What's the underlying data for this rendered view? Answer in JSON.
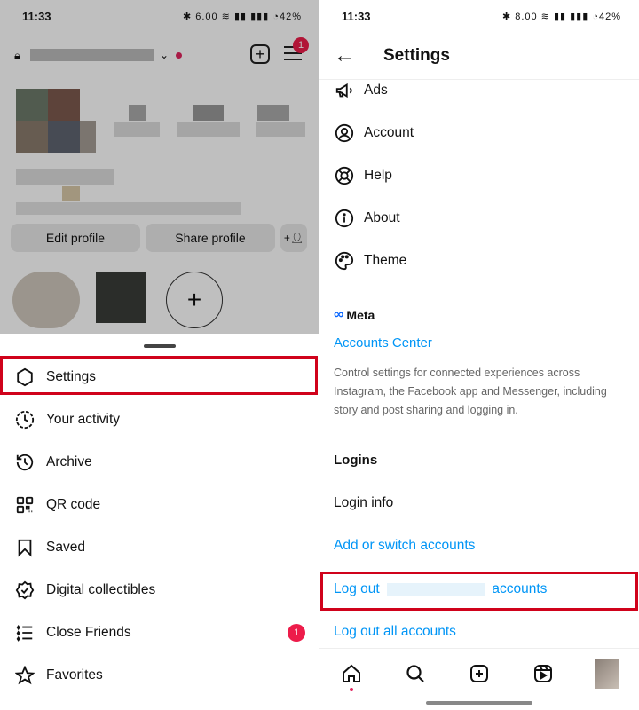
{
  "left": {
    "status": {
      "time": "11:33",
      "icons": "✱ 6.00 ≋ ▮▮ ▮▮▮ ◔42%"
    },
    "menu_badge": "1",
    "profile_buttons": {
      "edit": "Edit profile",
      "share": "Share profile"
    },
    "sheet_items": [
      {
        "label": "Settings",
        "icon": "settings-icon"
      },
      {
        "label": "Your activity",
        "icon": "activity-icon"
      },
      {
        "label": "Archive",
        "icon": "archive-icon"
      },
      {
        "label": "QR code",
        "icon": "qr-code-icon"
      },
      {
        "label": "Saved",
        "icon": "bookmark-icon"
      },
      {
        "label": "Digital collectibles",
        "icon": "collectibles-icon"
      },
      {
        "label": "Close Friends",
        "icon": "close-friends-icon",
        "badge": "1"
      },
      {
        "label": "Favorites",
        "icon": "star-icon"
      }
    ]
  },
  "right": {
    "status": {
      "time": "11:33",
      "icons": "✱ 8.00 ≋ ▮▮ ▮▮▮ ◔42%"
    },
    "title": "Settings",
    "items": [
      {
        "label": "Ads",
        "icon": "megaphone-icon"
      },
      {
        "label": "Account",
        "icon": "account-icon"
      },
      {
        "label": "Help",
        "icon": "help-icon"
      },
      {
        "label": "About",
        "icon": "info-icon"
      },
      {
        "label": "Theme",
        "icon": "palette-icon"
      }
    ],
    "meta": {
      "logo_text": "Meta",
      "accounts_center": "Accounts Center",
      "description": "Control settings for connected experiences across Instagram, the Facebook app and Messenger, including story and post sharing and logging in."
    },
    "logins": {
      "heading": "Logins",
      "login_info": "Login info",
      "add_switch": "Add or switch accounts",
      "log_out_prefix": "Log out",
      "log_out_suffix": "accounts",
      "log_out_all": "Log out all accounts"
    }
  },
  "colors": {
    "link": "#0095f6",
    "highlight": "#d0021b",
    "badge": "#ed1c4a"
  }
}
